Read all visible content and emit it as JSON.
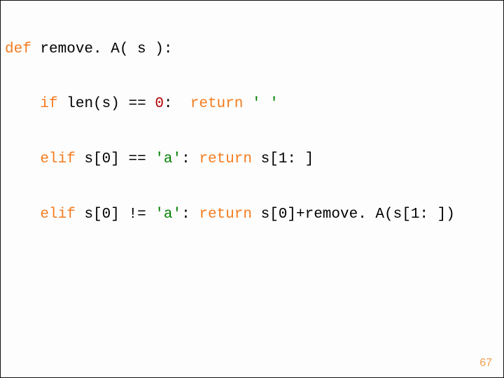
{
  "code": {
    "kw_def": "def",
    "fn_name": "remove. A",
    "params": "( s ):",
    "kw_if": "if",
    "len_call": "len(s)",
    "eqeq1": "==",
    "zero": "0",
    "colon1": ":",
    "kw_return1": "return",
    "empty_str": "' '",
    "kw_elif1": "elif",
    "s0_a": "s[0]",
    "eqeq2": "==",
    "a_str1": "'a'",
    "colon2": ":",
    "kw_return2": "return",
    "s_slice1": "s[1: ]",
    "kw_elif2": "elif",
    "s0_b": "s[0]",
    "neq": "!=",
    "a_str2": "'a'",
    "colon3": ":",
    "kw_return3": "return",
    "recur_expr": "s[0]+remove. A(s[1: ])"
  },
  "page_number": "67"
}
